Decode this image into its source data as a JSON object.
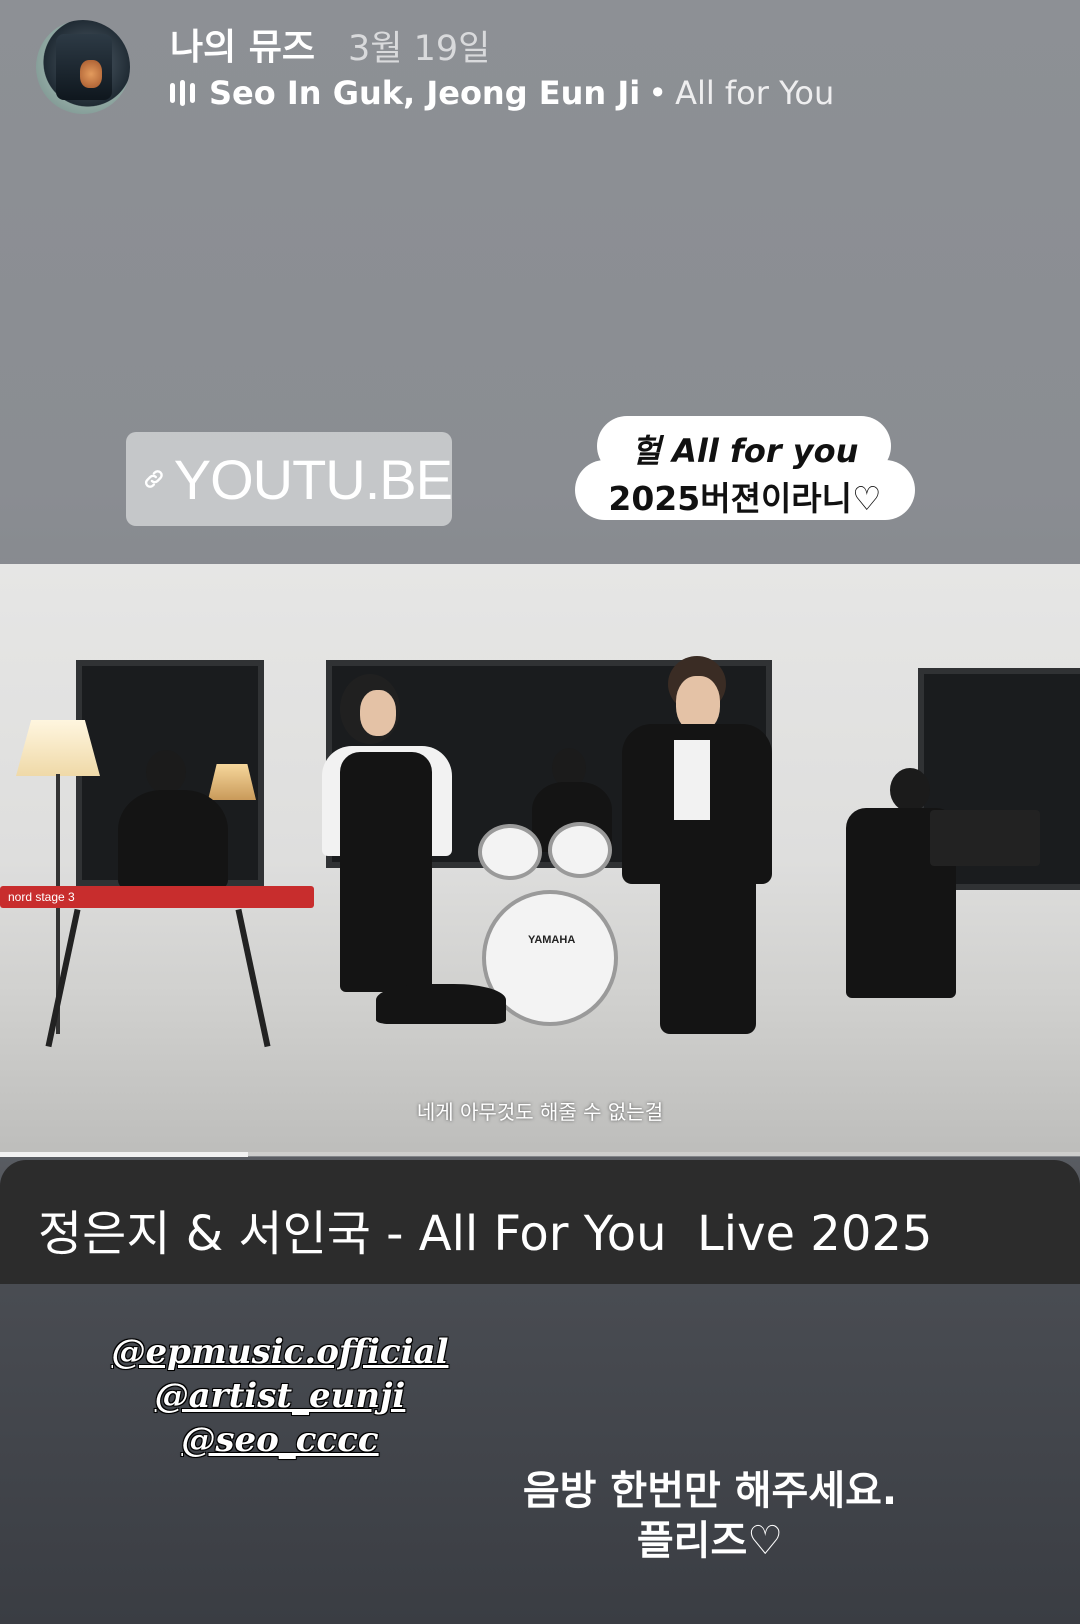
{
  "header": {
    "user_name": "나의 뮤즈",
    "date": "3월 19일",
    "music_artists": "Seo In Guk, Jeong Eun Ji",
    "music_separator": "•",
    "music_song": "All for You"
  },
  "link_sticker": {
    "text": "YOUTU.BE"
  },
  "speech_sticker": {
    "line1": "헐 All for you",
    "line2": "2025버젼이라니♡"
  },
  "video": {
    "subtitle": "네게 아무것도 해줄 수 없는걸",
    "keyboard_label": "nord stage 3",
    "drum_logo": "YAMAHA",
    "progress": 0.23
  },
  "title_bar": {
    "title": "정은지 & 서인국 - All For You  Live 2025"
  },
  "mentions": [
    "@epmusic.official",
    "@artist_eunji",
    "@seo_cccc"
  ],
  "plea": {
    "line1": "음방 한번만 해주세요.",
    "line2": "플리즈♡"
  },
  "colors": {
    "title_bar_bg": "#2c2c2c",
    "bubble_bg": "#ffffff",
    "link_sticker_bg": "#d2d4d6"
  }
}
